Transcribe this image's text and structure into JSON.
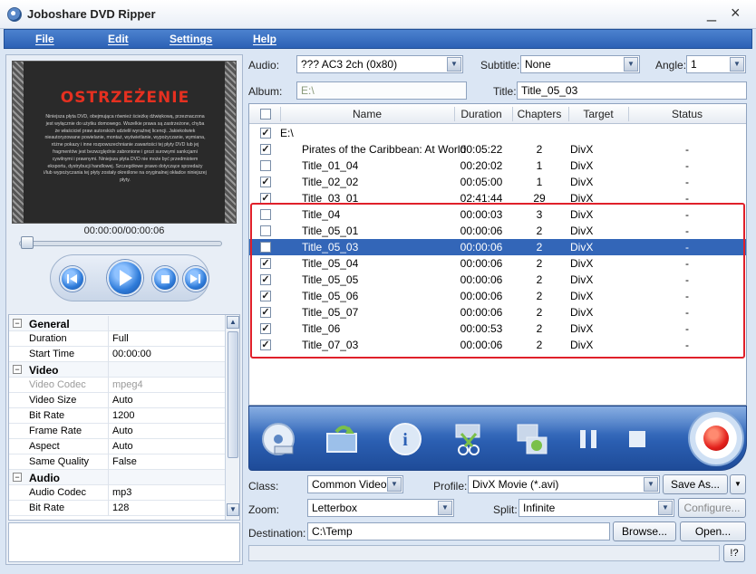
{
  "window": {
    "title": "Joboshare DVD Ripper",
    "minimize": "_",
    "close": "×"
  },
  "menu": [
    "File",
    "Edit",
    "Settings",
    "Help"
  ],
  "preview": {
    "warning_title": "OSTRZEŻENIE",
    "warning_text": "Niniejsza płyta DVD, obejmująca również ścieżkę dźwiękową, przeznaczona jest wyłącznie do użytku domowego. Wszelkie prawa są zastrzeżone, chyba że właściciel praw autorskich udzielił wyraźnej licencji. Jakiekolwiek nieautoryzowane powielanie, montaż, wyświetlanie, wypożyczanie, wymiana, różne pokazy i inne rozpowszechnianie zawartości tej płyty DVD lub jej fragmentów jest bezwzględnie zabronione i grozi surowymi sankcjami cywilnymi i prawnymi. Niniejsza płyta DVD nie może być przedmiotem eksportu, dystrybucji handlowej. Szczegółowe prawo dotyczące sprzedaży i/lub wypożyczania tej płyty zostały określone na oryginalnej okładce niniejszej płyty.",
    "time": "00:00:00/00:00:06",
    "seek_fraction": 0.02
  },
  "properties": [
    {
      "type": "group",
      "key": "General"
    },
    {
      "key": "Duration",
      "value": "Full"
    },
    {
      "key": "Start Time",
      "value": "00:00:00"
    },
    {
      "type": "group",
      "key": "Video"
    },
    {
      "key": "Video Codec",
      "value": "mpeg4",
      "disabled": true
    },
    {
      "key": "Video Size",
      "value": "Auto"
    },
    {
      "key": "Bit Rate",
      "value": "1200"
    },
    {
      "key": "Frame Rate",
      "value": "Auto"
    },
    {
      "key": "Aspect",
      "value": "Auto"
    },
    {
      "key": "Same Quality",
      "value": "False"
    },
    {
      "type": "group",
      "key": "Audio"
    },
    {
      "key": "Audio Codec",
      "value": "mp3"
    },
    {
      "key": "Bit Rate",
      "value": "128"
    }
  ],
  "top_controls": {
    "audio_label": "Audio:",
    "audio_value": "??? AC3 2ch (0x80)",
    "subtitle_label": "Subtitle:",
    "subtitle_value": "None",
    "angle_label": "Angle:",
    "angle_value": "1",
    "album_label": "Album:",
    "album_value": "E:\\",
    "title_label": "Title:",
    "title_value": "Title_05_03"
  },
  "list": {
    "headers": [
      "Name",
      "Duration",
      "Chapters",
      "Target",
      "Status"
    ],
    "root": "E:\\",
    "rows": [
      {
        "checked": true,
        "name": "Pirates of the Caribbean: At World",
        "duration": "00:05:22",
        "chapters": "2",
        "target": "DivX",
        "status": "-"
      },
      {
        "checked": false,
        "name": "Title_01_04",
        "duration": "00:20:02",
        "chapters": "1",
        "target": "DivX",
        "status": "-"
      },
      {
        "checked": true,
        "name": "Title_02_02",
        "duration": "00:05:00",
        "chapters": "1",
        "target": "DivX",
        "status": "-"
      },
      {
        "checked": true,
        "name": "Title_03_01",
        "duration": "02:41:44",
        "chapters": "29",
        "target": "DivX",
        "status": "-"
      },
      {
        "checked": false,
        "name": "Title_04",
        "duration": "00:00:03",
        "chapters": "3",
        "target": "DivX",
        "status": "-"
      },
      {
        "checked": false,
        "name": "Title_05_01",
        "duration": "00:00:06",
        "chapters": "2",
        "target": "DivX",
        "status": "-"
      },
      {
        "checked": false,
        "name": "Title_05_03",
        "duration": "00:00:06",
        "chapters": "2",
        "target": "DivX",
        "status": "-",
        "selected": true
      },
      {
        "checked": true,
        "name": "Title_05_04",
        "duration": "00:00:06",
        "chapters": "2",
        "target": "DivX",
        "status": "-"
      },
      {
        "checked": true,
        "name": "Title_05_05",
        "duration": "00:00:06",
        "chapters": "2",
        "target": "DivX",
        "status": "-"
      },
      {
        "checked": true,
        "name": "Title_05_06",
        "duration": "00:00:06",
        "chapters": "2",
        "target": "DivX",
        "status": "-"
      },
      {
        "checked": true,
        "name": "Title_05_07",
        "duration": "00:00:06",
        "chapters": "2",
        "target": "DivX",
        "status": "-"
      },
      {
        "checked": true,
        "name": "Title_06",
        "duration": "00:00:53",
        "chapters": "2",
        "target": "DivX",
        "status": "-"
      },
      {
        "checked": true,
        "name": "Title_07_03",
        "duration": "00:00:06",
        "chapters": "2",
        "target": "DivX",
        "status": "-"
      }
    ]
  },
  "toolbar_icons": [
    "load-dvd-icon",
    "open-folder-icon",
    "info-icon",
    "trim-icon",
    "merge-icon",
    "pause-icon",
    "stop-icon",
    "record-icon"
  ],
  "output": {
    "class_label": "Class:",
    "class_value": "Common Video",
    "profile_label": "Profile:",
    "profile_value": "DivX Movie  (*.avi)",
    "save_as": "Save As...",
    "zoom_label": "Zoom:",
    "zoom_value": "Letterbox",
    "split_label": "Split:",
    "split_value": "Infinite",
    "configure": "Configure...",
    "destination_label": "Destination:",
    "destination_value": "C:\\Temp",
    "browse": "Browse...",
    "open": "Open...",
    "help": "!?"
  },
  "colors": {
    "accent": "#2c61b5",
    "selected_row": "#3366b8",
    "highlight": "#e0202a"
  }
}
